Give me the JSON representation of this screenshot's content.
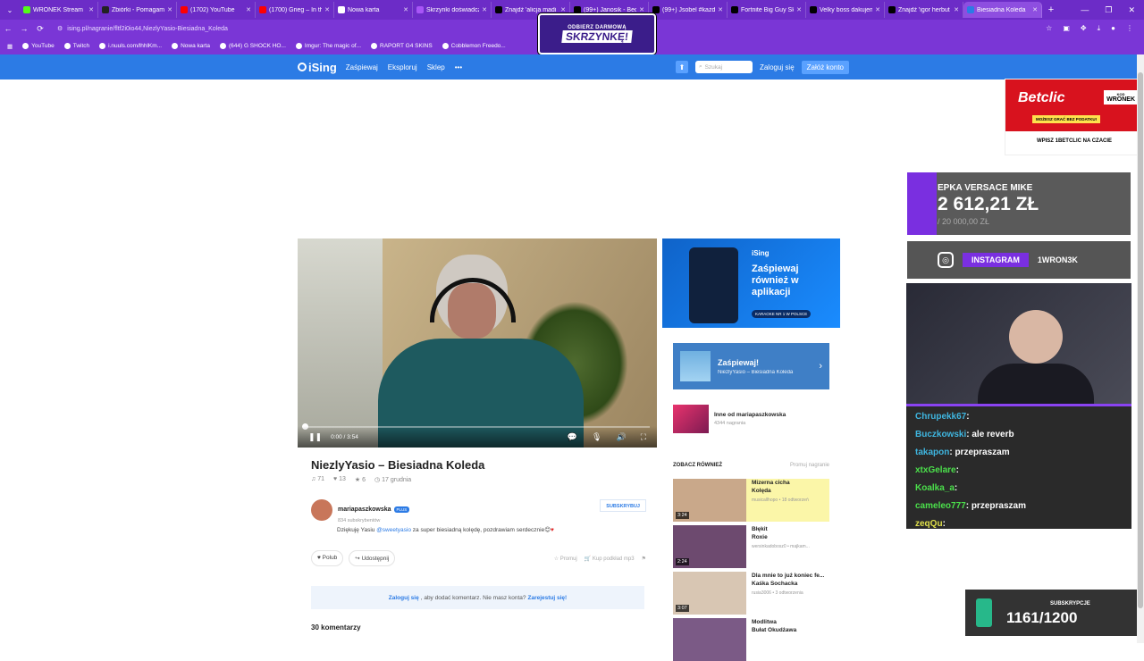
{
  "browser": {
    "tabs": [
      {
        "label": "WRONEK Stream",
        "color": "#53fc18"
      },
      {
        "label": "Zbiórki - Pomagam",
        "color": "#222222"
      },
      {
        "label": "(1702) YouTube",
        "color": "#ff0000"
      },
      {
        "label": "(1700) Grieg – In th",
        "color": "#ff0000"
      },
      {
        "label": "Nowa karta",
        "color": "#ffffff"
      },
      {
        "label": "Skrzynki doświadcz",
        "color": "#a855f7"
      },
      {
        "label": "Znajdź 'alicja madi",
        "color": "#000000"
      },
      {
        "label": "(99+) Janosik - Bed",
        "color": "#000000"
      },
      {
        "label": "(99+) Jsobel #każd",
        "color": "#000000"
      },
      {
        "label": "Fortnite Big Guy Sk",
        "color": "#000000"
      },
      {
        "label": "Velky boss dakujem",
        "color": "#000000"
      },
      {
        "label": "Znajdź 'igor herbut",
        "color": "#000000"
      },
      {
        "label": "Biesiadna Koleda",
        "color": "#2c7be5",
        "active": true
      }
    ],
    "url": "ising.pl/nagranie/fltf2i0io44,NiezlyYasio-Biesiadna_Koleda",
    "bookmarks": [
      "YouTube",
      "Twitch",
      "i.nuuls.com/lhhlKm...",
      "Nowa karta",
      "(644) G SHOCK HO...",
      "Imgur: The magic of...",
      "RAPORT G4 SKINS",
      "Cobblemon Freedo..."
    ]
  },
  "overlay_promo": {
    "small": "ODBIERZ DARMOWĄ",
    "large": "SKRZYNKĘ!"
  },
  "site_nav": {
    "logo": "iSing",
    "links": [
      "Zaśpiewaj",
      "Eksploruj",
      "Sklep"
    ],
    "more": "•••",
    "search_placeholder": "Szukaj",
    "login": "Zaloguj się",
    "register": "Załóż konto"
  },
  "player": {
    "time": "0:00 / 3:54",
    "progress_fraction": 0.0
  },
  "recording": {
    "title": "NiezlyYasio – Biesiadna Koleda",
    "plays": "71",
    "likes": "13",
    "stars": "6",
    "date": "17 grudnia",
    "author": "mariapaszkowska",
    "author_badge": "PLUS",
    "subscribers": "834 subskrybentów",
    "subscribe": "SUBSKRYBUJ",
    "comment_pre": "Dziękuję Yasiu ",
    "comment_mention": "@sweetyasio",
    "comment_post": " za super biesiadną kolędę, pozdrawiam serdecznie😊",
    "like_btn": "Polub",
    "share_btn": "Udostępnij",
    "promote": "Promuj",
    "buy_mp3": "Kup podkład mp3",
    "login_prompt_link": "Zaloguj się",
    "login_prompt_mid": ", aby dodać komentarz. Nie masz konta? ",
    "login_prompt_reg": "Zarejestuj się!",
    "comments_count": "30 komentarzy"
  },
  "app_ad": {
    "brand": "iSing",
    "title": "Zaśpiewaj również w aplikacji",
    "badge": "KARAOKE NR 1 W POLSCE"
  },
  "sing_box": {
    "title": "Zaśpiewaj!",
    "subtitle": "NiezlyYasio – Biesiadna Koleda"
  },
  "other_by": {
    "title": "Inne od mariapaszkowska",
    "count": "4344 nagrania"
  },
  "see_also": {
    "heading": "ZOBACZ RÓWNIEŻ",
    "promote": "Promuj nagranie"
  },
  "recommendations": [
    {
      "title1": "Mizerna cicha",
      "title2": "Kolęda",
      "meta": "musicallhopo • 18 odtworzeń",
      "duration": "3:24",
      "color": "#c9a88a",
      "highlight": true
    },
    {
      "title1": "Błękit",
      "title2": "Roxie",
      "meta": "wersinkadobosz0 • majkam...",
      "duration": "2:24",
      "color": "#6d4a6f",
      "highlight": false
    },
    {
      "title1": "Dla mnie to już koniec fe...",
      "title2": "Kaśka Sochacka",
      "meta": "rusia3006 • 3 odtworzenia",
      "duration": "3:07",
      "color": "#d8c6b3",
      "highlight": false
    },
    {
      "title1": "Modlitwa",
      "title2": "Bułat Okudżawa",
      "meta": "",
      "duration": "",
      "color": "#7b5a86",
      "highlight": false
    }
  ],
  "stream_overlay": {
    "betclic_logo": "Betclic",
    "betclic_code_label": "KOD",
    "betclic_code": "WRONEK",
    "betclic_strip": "MOŻESZ GRAĆ BEZ PODATKU!",
    "betclic_bottom": "WPISZ 1BETCLIC NA CZACIE",
    "goal_label": "EPKA VERSACE MIKE",
    "goal_amount": "2 612,21 ZŁ",
    "goal_target": "/ 20 000,00 ZŁ",
    "goal_fraction": 0.13,
    "insta_label": "INSTAGRAM",
    "insta_handle": "1WRON3K",
    "chat": [
      {
        "user": "Chrupekk67",
        "msg": "",
        "cls": "u"
      },
      {
        "user": "Buczkowski",
        "msg": "ale reverb",
        "cls": "u"
      },
      {
        "user": "takapon",
        "msg": "przepraszam",
        "cls": "u"
      },
      {
        "user": "xtxGelare",
        "msg": "",
        "cls": "u2"
      },
      {
        "user": "Koalka_a",
        "msg": "",
        "cls": "u2"
      },
      {
        "user": "cameleo777",
        "msg": "przepraszam",
        "cls": "u2"
      },
      {
        "user": "zeqQu",
        "msg": "",
        "cls": "u3"
      }
    ],
    "subs_label": "SUBSKRYPCJE",
    "subs_value": "1161/1200"
  }
}
